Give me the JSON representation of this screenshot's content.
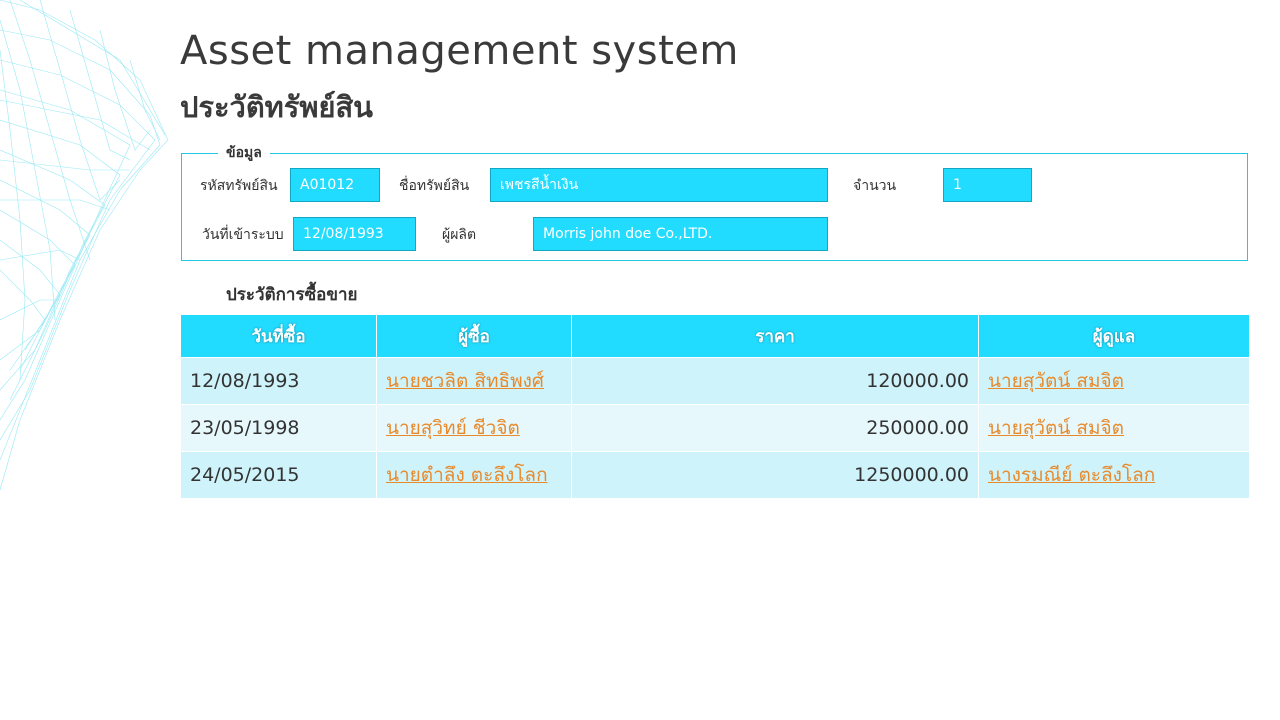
{
  "header": {
    "title": "Asset management system",
    "subtitle": "ประวัติทรัพย์สิน"
  },
  "info": {
    "legend": "ข้อมูล",
    "asset_code_label": "รหัสทรัพย์สิน",
    "asset_code": "A01012",
    "asset_name_label": "ชื่อทรัพย์สิน",
    "asset_name": "เพชรสีน้ำเงิน",
    "quantity_label": "จำนวน",
    "quantity": "1",
    "entry_date_label": "วันที่เข้าระบบ",
    "entry_date": "12/08/1993",
    "manufacturer_label": "ผู้ผลิต",
    "manufacturer": "Morris john doe Co.,LTD."
  },
  "history": {
    "section_label": "ประวัติการซื้อขาย",
    "columns": [
      "วันที่ซื้อ",
      "ผู้ซื้อ",
      "ราคา",
      "ผู้ดูแล"
    ],
    "rows": [
      {
        "date": "12/08/1993",
        "buyer": "นายชวลิต สิทธิพงศ์",
        "price": "120000.00",
        "caretaker": "นายสุวัตน์ สมจิต"
      },
      {
        "date": "23/05/1998",
        "buyer": "นายสุวิทย์ ชีวจิต",
        "price": "250000.00",
        "caretaker": "นายสุวัตน์ สมจิต"
      },
      {
        "date": "24/05/2015",
        "buyer": "นายตำลึง ตะลึงโลก",
        "price": "1250000.00",
        "caretaker": "นางรมณีย์ ตะลึงโลก"
      }
    ]
  },
  "colors": {
    "accent": "#22dcff",
    "link": "#e88a2c",
    "row_odd": "#cff3fa",
    "row_even": "#e6f8fc"
  }
}
